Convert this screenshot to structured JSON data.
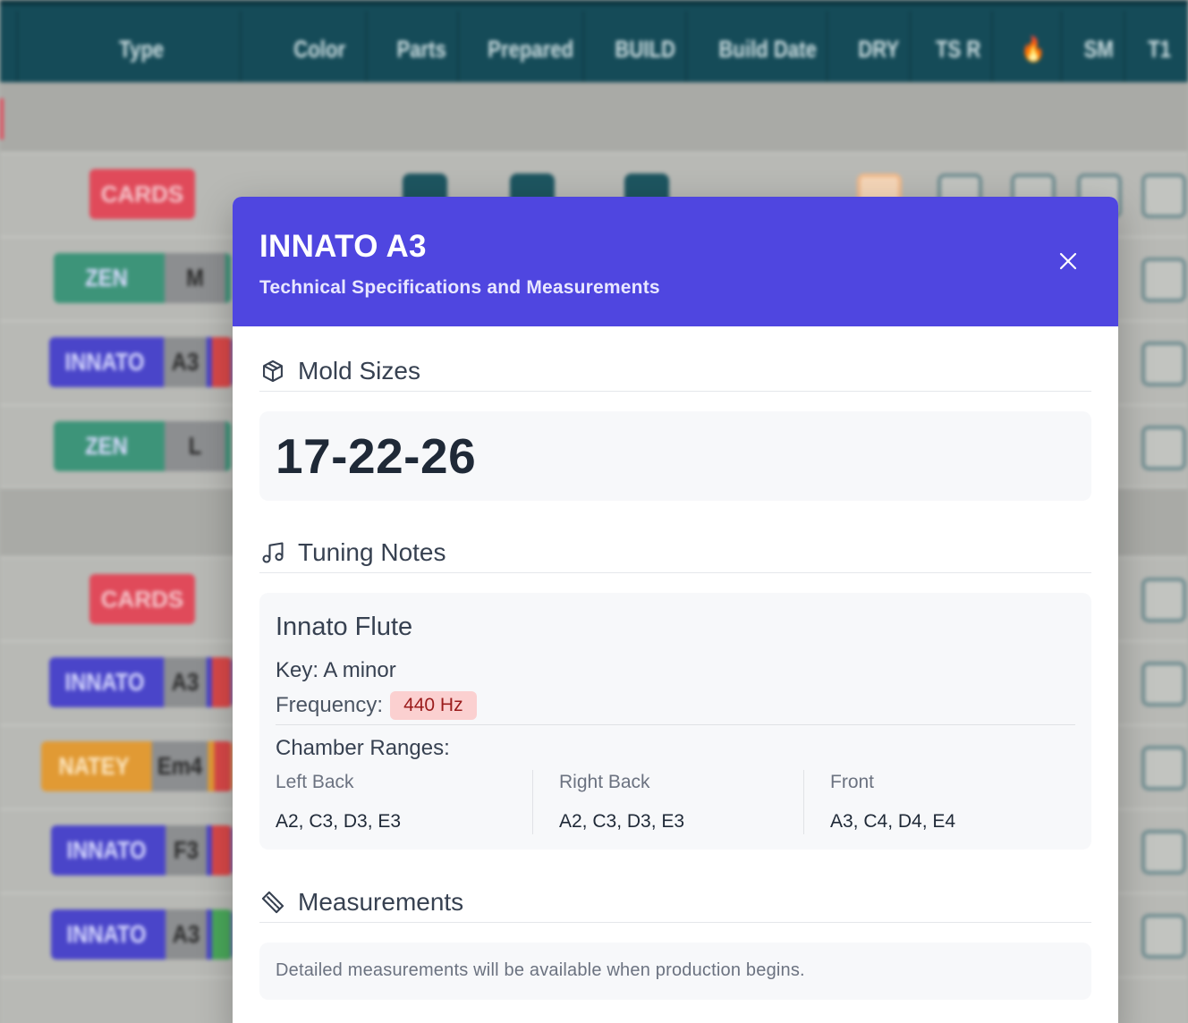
{
  "background_table": {
    "columns": [
      "Type",
      "Color",
      "Parts",
      "Prepared",
      "BUILD",
      "Build Date",
      "DRY",
      "TS R",
      "🔥",
      "SM",
      "T1"
    ],
    "tags": {
      "cards": "CARDS",
      "zen": "ZEN",
      "innato": "INNATO",
      "natey": "NATEY"
    },
    "rows": [
      {
        "tag": "CARDS"
      },
      {
        "tag": "ZEN",
        "size": "M"
      },
      {
        "tag": "INNATO",
        "size": "A3"
      },
      {
        "tag": "ZEN",
        "size": "L"
      },
      {
        "tag": "CARDS"
      },
      {
        "tag": "INNATO",
        "size": "A3"
      },
      {
        "tag": "NATEY",
        "size": "Em4"
      },
      {
        "tag": "INNATO",
        "size": "F3"
      },
      {
        "tag": "INNATO",
        "size": "A3"
      }
    ],
    "colors": {
      "header": "#154b58",
      "innato": "#4a45c9",
      "zen": "#3d9479",
      "natey": "#e19a34",
      "cards": "#e04a5a"
    }
  },
  "modal": {
    "title": "INNATO A3",
    "subtitle": "Technical Specifications and Measurements",
    "header_color": "#4f46e0",
    "close_icon": "close-icon",
    "mold_sizes": {
      "heading": "Mold Sizes",
      "icon": "cube-icon",
      "value": "17-22-26"
    },
    "tuning_notes": {
      "heading": "Tuning Notes",
      "icon": "music-note-icon",
      "instrument": "Innato Flute",
      "key": "Key: A minor",
      "frequency_label": "Frequency:",
      "frequency_value": "440 Hz",
      "chamber_heading": "Chamber Ranges:",
      "chambers": [
        {
          "label": "Left Back",
          "notes": "A2, C3, D3, E3"
        },
        {
          "label": "Right Back",
          "notes": "A2, C3, D3, E3"
        },
        {
          "label": "Front",
          "notes": "A3, C4, D4, E4"
        }
      ]
    },
    "measurements": {
      "heading": "Measurements",
      "icon": "ruler-icon",
      "text": "Detailed measurements will be available when production begins."
    }
  }
}
